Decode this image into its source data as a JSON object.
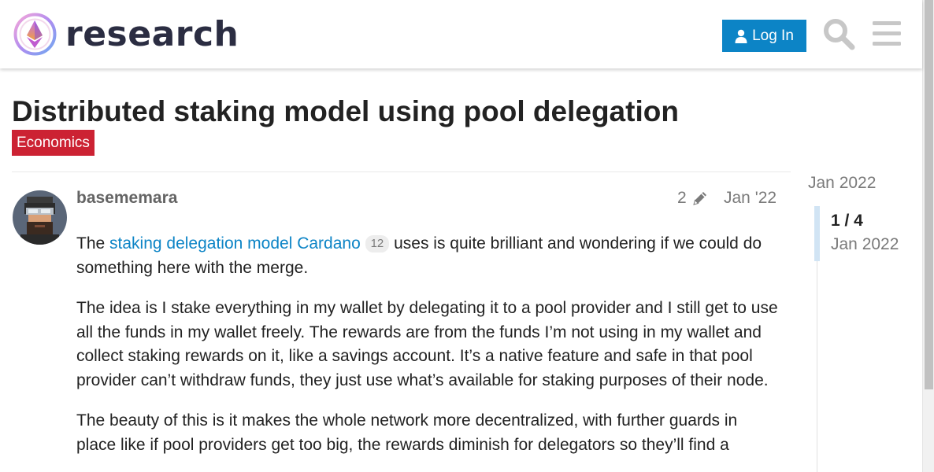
{
  "header": {
    "site_name": "research",
    "login_label": "Log In",
    "icons": [
      "site-logo-icon",
      "user-icon",
      "search-icon",
      "hamburger-menu-icon"
    ]
  },
  "topic": {
    "title": "Distributed staking model using pool delegation",
    "category": "Economics",
    "category_color": "#cc2233"
  },
  "post": {
    "username": "basememara",
    "edit_count": "2",
    "date": "Jan '22",
    "paragraph1": {
      "before": "The ",
      "link_text": "staking delegation model Cardano",
      "link_clicks": "12",
      "after": " uses is quite brilliant and wondering if we could do something here with the merge."
    },
    "paragraph2": "The idea is I stake everything in my wallet by delegating it to a pool provider and I still get to use all the funds in my wallet freely. The rewards are from the funds I’m not using in my wallet and collect staking rewards on it, like a savings account. It’s a native feature and safe in that pool provider can’t withdraw funds, they just use what’s available for staking purposes of their node.",
    "paragraph3": "The beauty of this is it makes the whole network more decentralized, with further guards in place like if pool providers get too big, the rewards diminish for delegators so they’ll find a"
  },
  "timeline": {
    "start_date": "Jan 2022",
    "progress": "1 / 4",
    "current_date": "Jan 2022"
  },
  "colors": {
    "accent": "#0c84c6",
    "category": "#cc2233"
  }
}
